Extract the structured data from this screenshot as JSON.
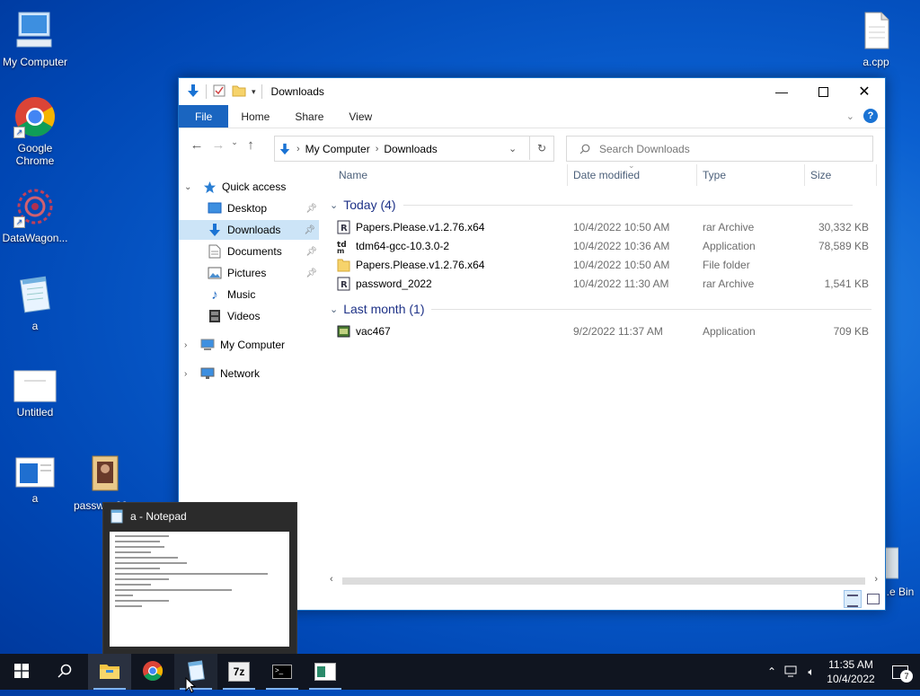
{
  "desktop": {
    "icons": [
      {
        "label": "My Computer"
      },
      {
        "label": "Google Chrome"
      },
      {
        "label": "DataWagon..."
      },
      {
        "label": "a"
      },
      {
        "label": "Untitled"
      },
      {
        "label": "a"
      },
      {
        "label": "passw... 20..."
      },
      {
        "label": "a.cpp"
      },
      {
        "label": "...e Bin"
      }
    ]
  },
  "explorer": {
    "title": "Downloads",
    "ribbon_tabs": [
      "File",
      "Home",
      "Share",
      "View"
    ],
    "address": {
      "root": "My Computer",
      "current": "Downloads"
    },
    "search_placeholder": "Search Downloads",
    "nav": {
      "quick_access": "Quick access",
      "items": [
        "Desktop",
        "Downloads",
        "Documents",
        "Pictures",
        "Music",
        "Videos"
      ],
      "my_computer": "My Computer",
      "network": "Network"
    },
    "columns": [
      "Name",
      "Date modified",
      "Type",
      "Size"
    ],
    "groups": [
      {
        "label": "Today (4)",
        "files": [
          {
            "name": "Papers.Please.v1.2.76.x64",
            "date": "10/4/2022 10:50 AM",
            "type": "rar Archive",
            "size": "30,332 KB"
          },
          {
            "name": "tdm64-gcc-10.3.0-2",
            "date": "10/4/2022 10:36 AM",
            "type": "Application",
            "size": "78,589 KB"
          },
          {
            "name": "Papers.Please.v1.2.76.x64",
            "date": "10/4/2022 10:50 AM",
            "type": "File folder",
            "size": ""
          },
          {
            "name": "password_2022",
            "date": "10/4/2022 11:30 AM",
            "type": "rar Archive",
            "size": "1,541 KB"
          }
        ]
      },
      {
        "label": "Last month (1)",
        "files": [
          {
            "name": "vac467",
            "date": "9/2/2022 11:37 AM",
            "type": "Application",
            "size": "709 KB"
          }
        ]
      }
    ]
  },
  "preview": {
    "title": "a - Notepad"
  },
  "taskbar": {
    "time": "11:35 AM",
    "date": "10/4/2022",
    "notification_count": "7"
  },
  "colors": {
    "accent": "#1a65c0",
    "selection": "#cce4f7",
    "group": "#1e3287"
  }
}
